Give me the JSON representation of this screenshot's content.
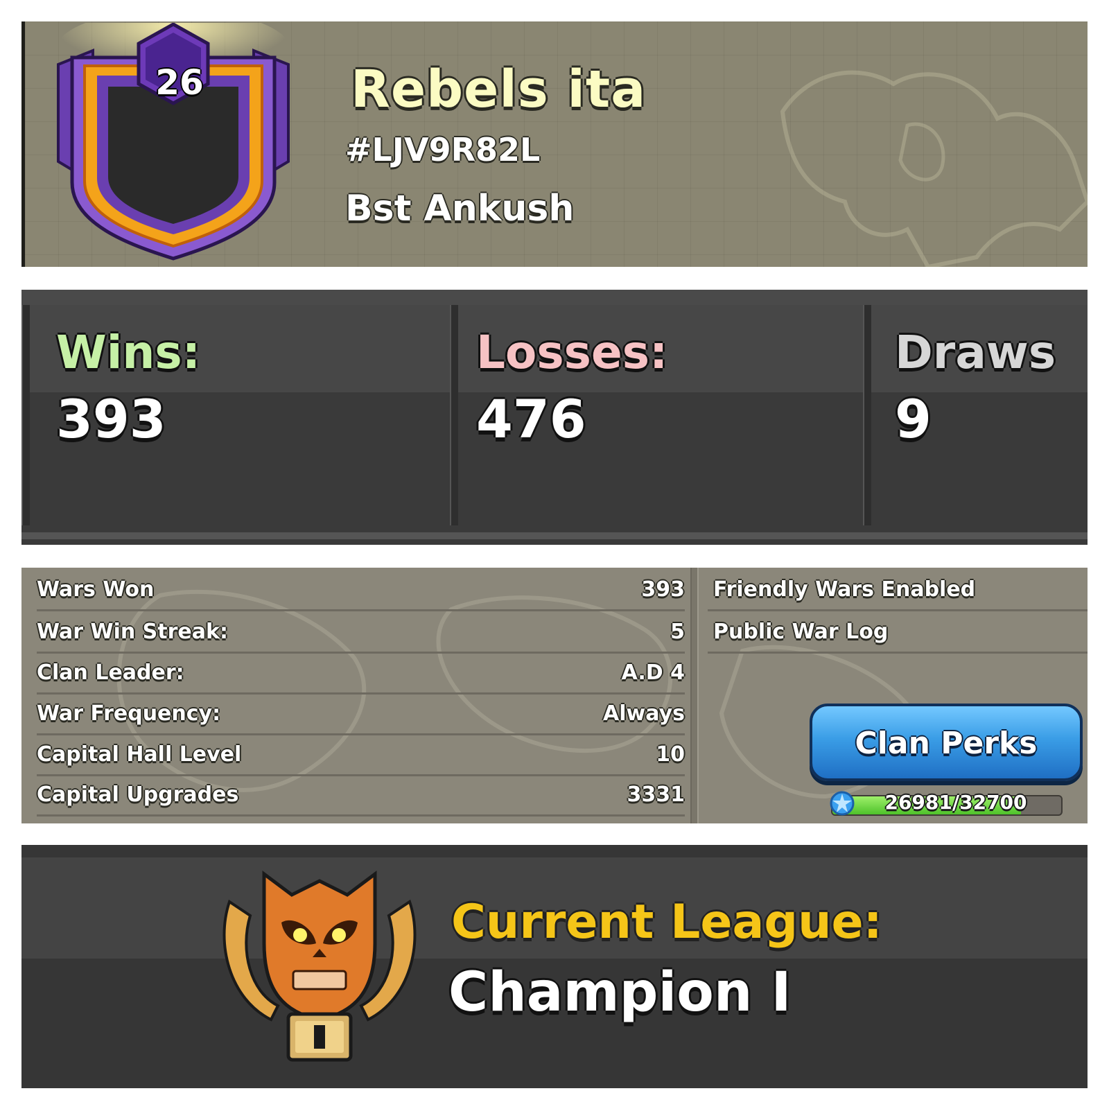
{
  "clan": {
    "level": "26",
    "name": "Rebels ita",
    "tag": "#LJV9R82L",
    "subtitle": "Bst Ankush"
  },
  "war_record": {
    "wins_label": "Wins:",
    "wins_value": "393",
    "losses_label": "Losses:",
    "losses_value": "476",
    "draws_label": "Draws",
    "draws_value": "9",
    "colors": {
      "wins": "#c6f0a6",
      "losses": "#f6c2c4",
      "draws": "#d6d6d6"
    }
  },
  "details": {
    "rows": [
      {
        "label": "Wars Won",
        "value": "393"
      },
      {
        "label": "War Win Streak:",
        "value": "5"
      },
      {
        "label": "Clan Leader:",
        "value": "A.D 4"
      },
      {
        "label": "War Frequency:",
        "value": "Always"
      },
      {
        "label": "Capital Hall Level",
        "value": "10"
      },
      {
        "label": "Capital Upgrades",
        "value": "3331"
      }
    ],
    "right_rows": [
      {
        "label": "Friendly Wars Enabled"
      },
      {
        "label": "Public War Log"
      }
    ],
    "perks_button": "Clan Perks",
    "xp": {
      "text": "26981/32700",
      "fraction": 0.825
    }
  },
  "league": {
    "label": "Current League:",
    "name": "Champion I",
    "icon": "champion-league-skull-icon",
    "tier_mark": "I"
  }
}
